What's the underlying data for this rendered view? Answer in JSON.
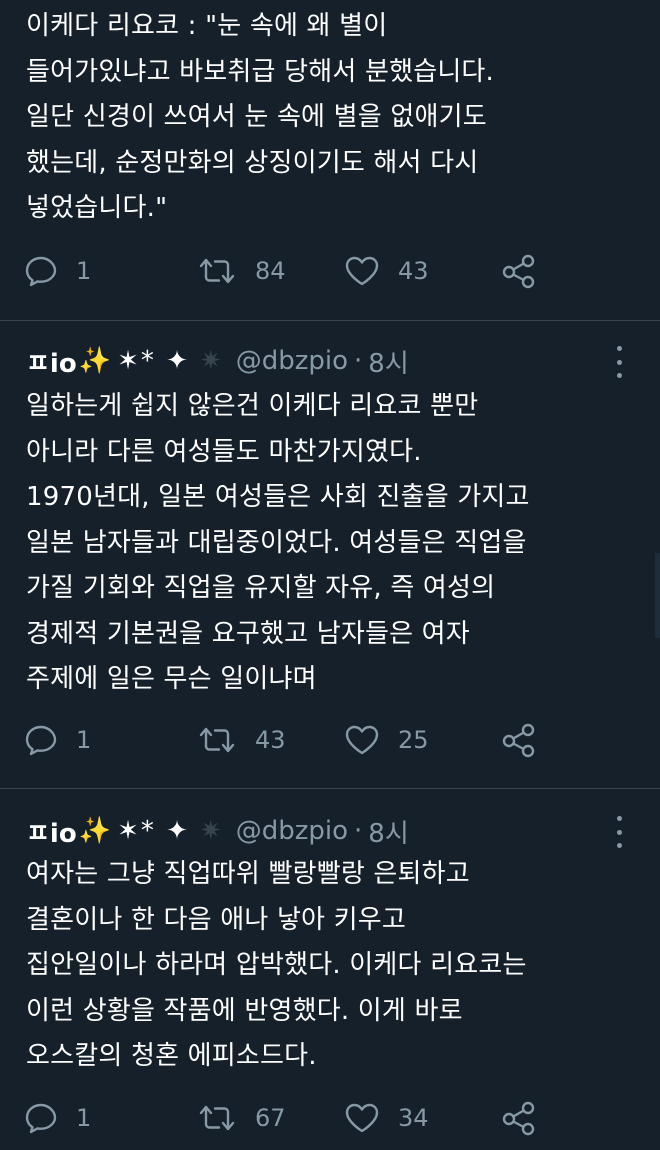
{
  "colors": {
    "background": "#15202b",
    "text": "#ffffff",
    "secondary": "#8899a6",
    "divider": "#38444d",
    "sparkle": "#f6c343"
  },
  "tweets": [
    {
      "text": "이케다 리요코 : \"눈 속에 왜 별이\n들어가있냐고 바보취급 당해서 분했습니다.\n일단 신경이 쓰여서 눈 속에 별을 없애기도\n했는데, 순정만화의 상징이기도 해서 다시\n넣었습니다.\"",
      "replies": "1",
      "retweets": "84",
      "likes": "43"
    },
    {
      "author": {
        "name": "ㅍio",
        "sparkle": "✨",
        "stars": "✶* ✦",
        "grey_star": "✷",
        "handle": "@dbzpio",
        "dot": "·",
        "time": "8시"
      },
      "text": "일하는게 쉽지 않은건 이케다 리요코 뿐만\n아니라 다른 여성들도 마찬가지였다.\n1970년대, 일본 여성들은 사회 진출을 가지고\n일본 남자들과 대립중이었다. 여성들은 직업을\n가질 기회와 직업을 유지할 자유, 즉 여성의\n경제적 기본권을 요구했고 남자들은 여자\n주제에 일은 무슨 일이냐며",
      "replies": "1",
      "retweets": "43",
      "likes": "25"
    },
    {
      "author": {
        "name": "ㅍio",
        "sparkle": "✨",
        "stars": "✶* ✦",
        "grey_star": "✷",
        "handle": "@dbzpio",
        "dot": "·",
        "time": "8시"
      },
      "text": "여자는 그냥 직업따위 빨랑빨랑 은퇴하고\n결혼이나 한 다음 애나 낳아 키우고\n집안일이나 하라며 압박했다. 이케다 리요코는\n이런 상황을 작품에 반영했다. 이게 바로\n오스칼의 청혼 에피소드다.",
      "replies": "1",
      "retweets": "67",
      "likes": "34"
    }
  ],
  "icons": {
    "reply": "reply-bubble-icon",
    "retweet": "retweet-arrows-icon",
    "like": "heart-outline-icon",
    "share": "share-nodes-icon",
    "more": "more-vertical-icon"
  }
}
